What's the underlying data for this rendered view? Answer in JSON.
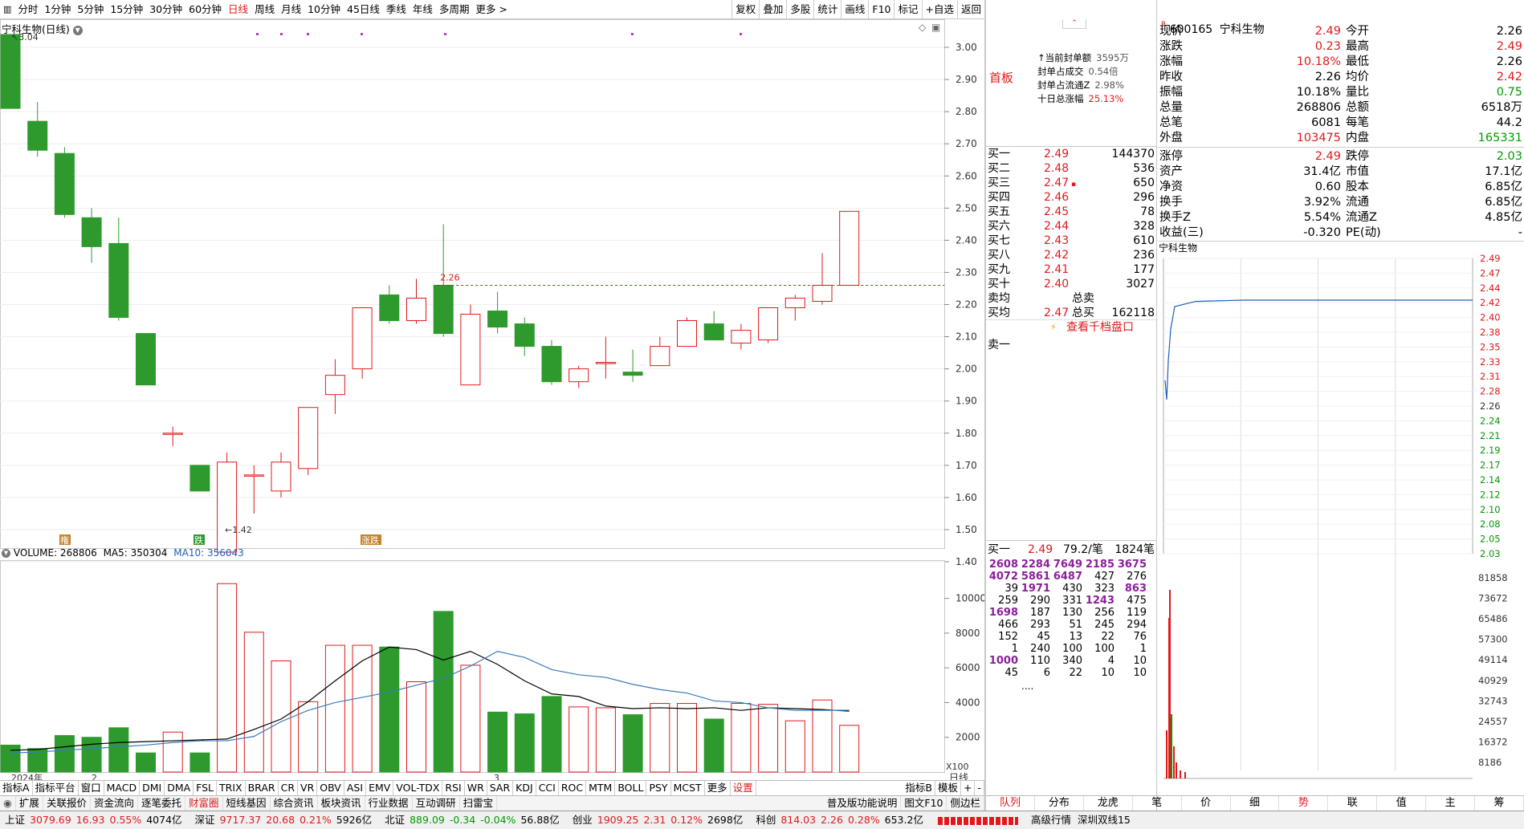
{
  "toolbar": {
    "periods": [
      "分时",
      "1分钟",
      "5分钟",
      "15分钟",
      "30分钟",
      "60分钟",
      "日线",
      "周线",
      "月线",
      "10分钟",
      "45日线",
      "季线",
      "年线",
      "多周期",
      "更多 >"
    ],
    "active_period": "日线",
    "tools": [
      "复权",
      "叠加",
      "多股",
      "统计",
      "画线",
      "F10",
      "标记",
      "+自选",
      "返回"
    ]
  },
  "chart": {
    "title": "宁科生物(日线)",
    "high_label": "3.04",
    "low_label": "1.42",
    "ref_label": "2.26",
    "price_axis": [
      "3.00",
      "2.90",
      "2.80",
      "2.70",
      "2.60",
      "2.50",
      "2.40",
      "2.30",
      "2.20",
      "2.10",
      "2.00",
      "1.90",
      "1.80",
      "1.70",
      "1.60",
      "1.50",
      "1.40"
    ],
    "vol_axis": [
      "10000",
      "8000",
      "6000",
      "4000",
      "2000"
    ],
    "vol_unit": "X100",
    "date_labels": [
      "2024年",
      "2",
      "3"
    ],
    "markers": [
      "権",
      "跌",
      "涨跌"
    ],
    "period_label": "日线",
    "vol_title": {
      "name": "VOLUME: 268806",
      "ma5": "MA5: 350304",
      "ma10": "MA10: 356043"
    }
  },
  "chart_data": {
    "type": "candlestick",
    "ohlc": [
      [
        3.04,
        2.81,
        3.04,
        2.81
      ],
      [
        2.77,
        2.68,
        2.83,
        2.66
      ],
      [
        2.67,
        2.48,
        2.69,
        2.47
      ],
      [
        2.47,
        2.38,
        2.5,
        2.33
      ],
      [
        2.39,
        2.16,
        2.47,
        2.15
      ],
      [
        2.11,
        1.95,
        2.11,
        1.95
      ],
      [
        1.8,
        1.8,
        1.82,
        1.76
      ],
      [
        1.7,
        1.62,
        1.7,
        1.62
      ],
      [
        1.43,
        1.71,
        1.74,
        1.42
      ],
      [
        1.67,
        1.67,
        1.7,
        1.55
      ],
      [
        1.62,
        1.71,
        1.74,
        1.6
      ],
      [
        1.69,
        1.88,
        1.88,
        1.67
      ],
      [
        1.92,
        1.98,
        2.03,
        1.86
      ],
      [
        2.0,
        2.19,
        2.19,
        1.97
      ],
      [
        2.23,
        2.15,
        2.26,
        2.14
      ],
      [
        2.15,
        2.22,
        2.28,
        2.14
      ],
      [
        2.26,
        2.11,
        2.45,
        2.1
      ],
      [
        1.95,
        2.17,
        2.2,
        1.95
      ],
      [
        2.18,
        2.13,
        2.24,
        2.11
      ],
      [
        2.14,
        2.07,
        2.16,
        2.04
      ],
      [
        2.07,
        1.96,
        2.09,
        1.95
      ],
      [
        1.96,
        2.0,
        2.01,
        1.94
      ],
      [
        2.02,
        2.02,
        2.1,
        1.97
      ],
      [
        1.99,
        1.98,
        2.06,
        1.96
      ],
      [
        2.01,
        2.07,
        2.1,
        2.01
      ],
      [
        2.07,
        2.15,
        2.16,
        2.07
      ],
      [
        2.14,
        2.09,
        2.18,
        2.09
      ],
      [
        2.08,
        2.12,
        2.14,
        2.06
      ],
      [
        2.09,
        2.19,
        2.19,
        2.08
      ],
      [
        2.19,
        2.22,
        2.23,
        2.15
      ],
      [
        2.21,
        2.26,
        2.36,
        2.2
      ],
      [
        2.26,
        2.49,
        2.49,
        2.26
      ]
    ],
    "volume": [
      1550,
      1350,
      2100,
      2000,
      2550,
      1100,
      2300,
      1100,
      10850,
      8050,
      6400,
      4050,
      7300,
      7300,
      7200,
      5200,
      9250,
      6150,
      3450,
      3350,
      4350,
      3750,
      3700,
      3300,
      3950,
      3950,
      3050,
      3950,
      3900,
      2950,
      4150,
      2688
    ],
    "ma5": [
      1250,
      1300,
      1450,
      1600,
      1700,
      1750,
      1800,
      1850,
      1900,
      2450,
      3050,
      4050,
      5250,
      6400,
      7200,
      7050,
      6450,
      6950,
      6200,
      5250,
      4500,
      4350,
      3800,
      3650,
      3700,
      3650,
      3700,
      3550,
      3700,
      3650,
      3600,
      3503
    ],
    "ma10": [
      1100,
      1150,
      1250,
      1350,
      1450,
      1550,
      1700,
      1800,
      1800,
      2050,
      2900,
      3550,
      4000,
      4300,
      4600,
      5000,
      5400,
      6100,
      6950,
      6600,
      5900,
      5600,
      5450,
      5050,
      4750,
      4550,
      4100,
      4000,
      3700,
      3550,
      3550,
      3560
    ],
    "ylim": [
      1.4,
      3.04
    ],
    "vol_max": 11000
  },
  "seal": {
    "badge": "首板",
    "rows": [
      {
        "label": "当前封单额",
        "value": "3595万"
      },
      {
        "label": "封单占成交",
        "value": "0.54倍"
      },
      {
        "label": "封单占流通Z",
        "value": "2.98%"
      },
      {
        "label": "十日总涨幅",
        "value": "25.13%"
      }
    ]
  },
  "quote": {
    "code": "600165",
    "name": "宁科生物",
    "left": [
      {
        "label": "现价",
        "value": "2.49",
        "color": "red"
      },
      {
        "label": "涨跌",
        "value": "0.23",
        "color": "red"
      },
      {
        "label": "涨幅",
        "value": "10.18%",
        "color": "red"
      },
      {
        "label": "昨收",
        "value": "2.26",
        "color": "black"
      },
      {
        "label": "振幅",
        "value": "10.18%",
        "color": "black"
      },
      {
        "label": "总量",
        "value": "268806",
        "color": "black"
      },
      {
        "label": "总笔",
        "value": "6081",
        "color": "black"
      },
      {
        "label": "外盘",
        "value": "103475",
        "color": "red"
      }
    ],
    "right": [
      {
        "label": "今开",
        "value": "2.26",
        "color": "black"
      },
      {
        "label": "最高",
        "value": "2.49",
        "color": "red"
      },
      {
        "label": "最低",
        "value": "2.26",
        "color": "black"
      },
      {
        "label": "均价",
        "value": "2.42",
        "color": "red"
      },
      {
        "label": "量比",
        "value": "0.75",
        "color": "green"
      },
      {
        "label": "总额",
        "value": "6518万",
        "color": "black"
      },
      {
        "label": "每笔",
        "value": "44.2",
        "color": "black"
      },
      {
        "label": "内盘",
        "value": "165331",
        "color": "green"
      }
    ],
    "left2": [
      {
        "label": "涨停",
        "value": "2.49",
        "color": "red"
      },
      {
        "label": "资产",
        "value": "31.4亿",
        "color": "black"
      },
      {
        "label": "净资",
        "value": "0.60",
        "color": "black"
      },
      {
        "label": "换手",
        "value": "3.92%",
        "color": "black"
      },
      {
        "label": "换手Z",
        "value": "5.54%",
        "color": "black"
      },
      {
        "label": "收益(三)",
        "value": "-0.320",
        "color": "black"
      }
    ],
    "right2": [
      {
        "label": "跌停",
        "value": "2.03",
        "color": "green"
      },
      {
        "label": "市值",
        "value": "17.1亿",
        "color": "black"
      },
      {
        "label": "股本",
        "value": "6.85亿",
        "color": "black"
      },
      {
        "label": "流通",
        "value": "6.85亿",
        "color": "black"
      },
      {
        "label": "流通Z",
        "value": "4.85亿",
        "color": "black"
      },
      {
        "label": "PE(动)",
        "value": "-",
        "color": "black"
      }
    ]
  },
  "book": {
    "bids": [
      {
        "label": "买一",
        "price": "2.49",
        "vol": "144370"
      },
      {
        "label": "买二",
        "price": "2.48",
        "vol": "536"
      },
      {
        "label": "买三",
        "price": "2.47",
        "vol": "650"
      },
      {
        "label": "买四",
        "price": "2.46",
        "vol": "296"
      },
      {
        "label": "买五",
        "price": "2.45",
        "vol": "78"
      },
      {
        "label": "买六",
        "price": "2.44",
        "vol": "328"
      },
      {
        "label": "买七",
        "price": "2.43",
        "vol": "610"
      },
      {
        "label": "买八",
        "price": "2.42",
        "vol": "236"
      },
      {
        "label": "买九",
        "price": "2.41",
        "vol": "177"
      },
      {
        "label": "买十",
        "price": "2.40",
        "vol": "3027"
      }
    ],
    "ask_avg_label": "卖均",
    "total_sell_label": "总卖",
    "bid_avg_label": "买均",
    "bid_avg": "2.47",
    "total_buy_label": "总买",
    "total_buy": "162118",
    "more_label": "查看千档盘口",
    "sell1_label": "卖一"
  },
  "queue": {
    "label": "买一",
    "price": "2.49",
    "avg": "79.2/笔",
    "count": "1824笔",
    "rows": [
      [
        "2608",
        "2284",
        "7649",
        "2185",
        "3675"
      ],
      [
        "4072",
        "5861",
        "6487",
        "427",
        "276"
      ],
      [
        "39",
        "1971",
        "430",
        "323",
        "863"
      ],
      [
        "259",
        "290",
        "331",
        "1243",
        "475"
      ],
      [
        "1698",
        "187",
        "130",
        "256",
        "119"
      ],
      [
        "466",
        "293",
        "51",
        "245",
        "294"
      ],
      [
        "152",
        "45",
        "13",
        "22",
        "76"
      ],
      [
        "1",
        "240",
        "100",
        "100",
        "1"
      ],
      [
        "1000",
        "110",
        "340",
        "4",
        "10"
      ],
      [
        "45",
        "6",
        "22",
        "10",
        "10"
      ]
    ],
    "more": "...."
  },
  "intraday": {
    "title": "宁科生物",
    "price_axis": [
      "2.49",
      "2.47",
      "2.44",
      "2.42",
      "2.40",
      "2.38",
      "2.35",
      "2.33",
      "2.31",
      "2.28",
      "2.26",
      "2.24",
      "2.21",
      "2.19",
      "2.17",
      "2.14",
      "2.12",
      "2.10",
      "2.08",
      "2.05",
      "2.03"
    ],
    "vol_axis": [
      "81858",
      "73672",
      "65486",
      "57300",
      "49114",
      "40929",
      "32743",
      "24557",
      "16372",
      "8186"
    ]
  },
  "indicators": [
    "指标A",
    "指标平台",
    "窗口",
    "MACD",
    "DMI",
    "DMA",
    "FSL",
    "TRIX",
    "BRAR",
    "CR",
    "VR",
    "OBV",
    "ASI",
    "EMV",
    "VOL-TDX",
    "RSI",
    "WR",
    "SAR",
    "KDJ",
    "CCI",
    "ROC",
    "MTM",
    "BOLL",
    "PSY",
    "MCST",
    "更多",
    "设置"
  ],
  "indicators_right": [
    "指标B",
    "模板",
    "+",
    "-"
  ],
  "tabs": [
    "扩展",
    "关联报价",
    "资金流向",
    "逐笔委托",
    "财富圈",
    "短线基因",
    "综合资讯",
    "板块资讯",
    "行业数据",
    "互动调研",
    "扫雷宝"
  ],
  "tabs_right": [
    "普及版功能说明",
    "图文F10",
    "侧边栏"
  ],
  "right_tabs": [
    "队列",
    "分布",
    "龙虎",
    "笔",
    "价",
    "细",
    "势",
    "联",
    "值",
    "主",
    "筹"
  ],
  "status": [
    {
      "name": "上证",
      "value": "3079.69",
      "chg": "16.93",
      "pct": "0.55%",
      "amt": "4074亿"
    },
    {
      "name": "深证",
      "value": "9717.37",
      "chg": "20.68",
      "pct": "0.21%",
      "amt": "5926亿"
    },
    {
      "name": "北证",
      "value": "889.09",
      "chg": "-0.34",
      "pct": "-0.04%",
      "amt": "56.88亿"
    },
    {
      "name": "创业",
      "value": "1909.25",
      "chg": "2.31",
      "pct": "0.12%",
      "amt": "2698亿"
    },
    {
      "name": "科创",
      "value": "814.03",
      "chg": "2.26",
      "pct": "0.28%",
      "amt": "653.2亿"
    }
  ],
  "status_right": [
    "高级行情",
    "深圳双线15"
  ]
}
